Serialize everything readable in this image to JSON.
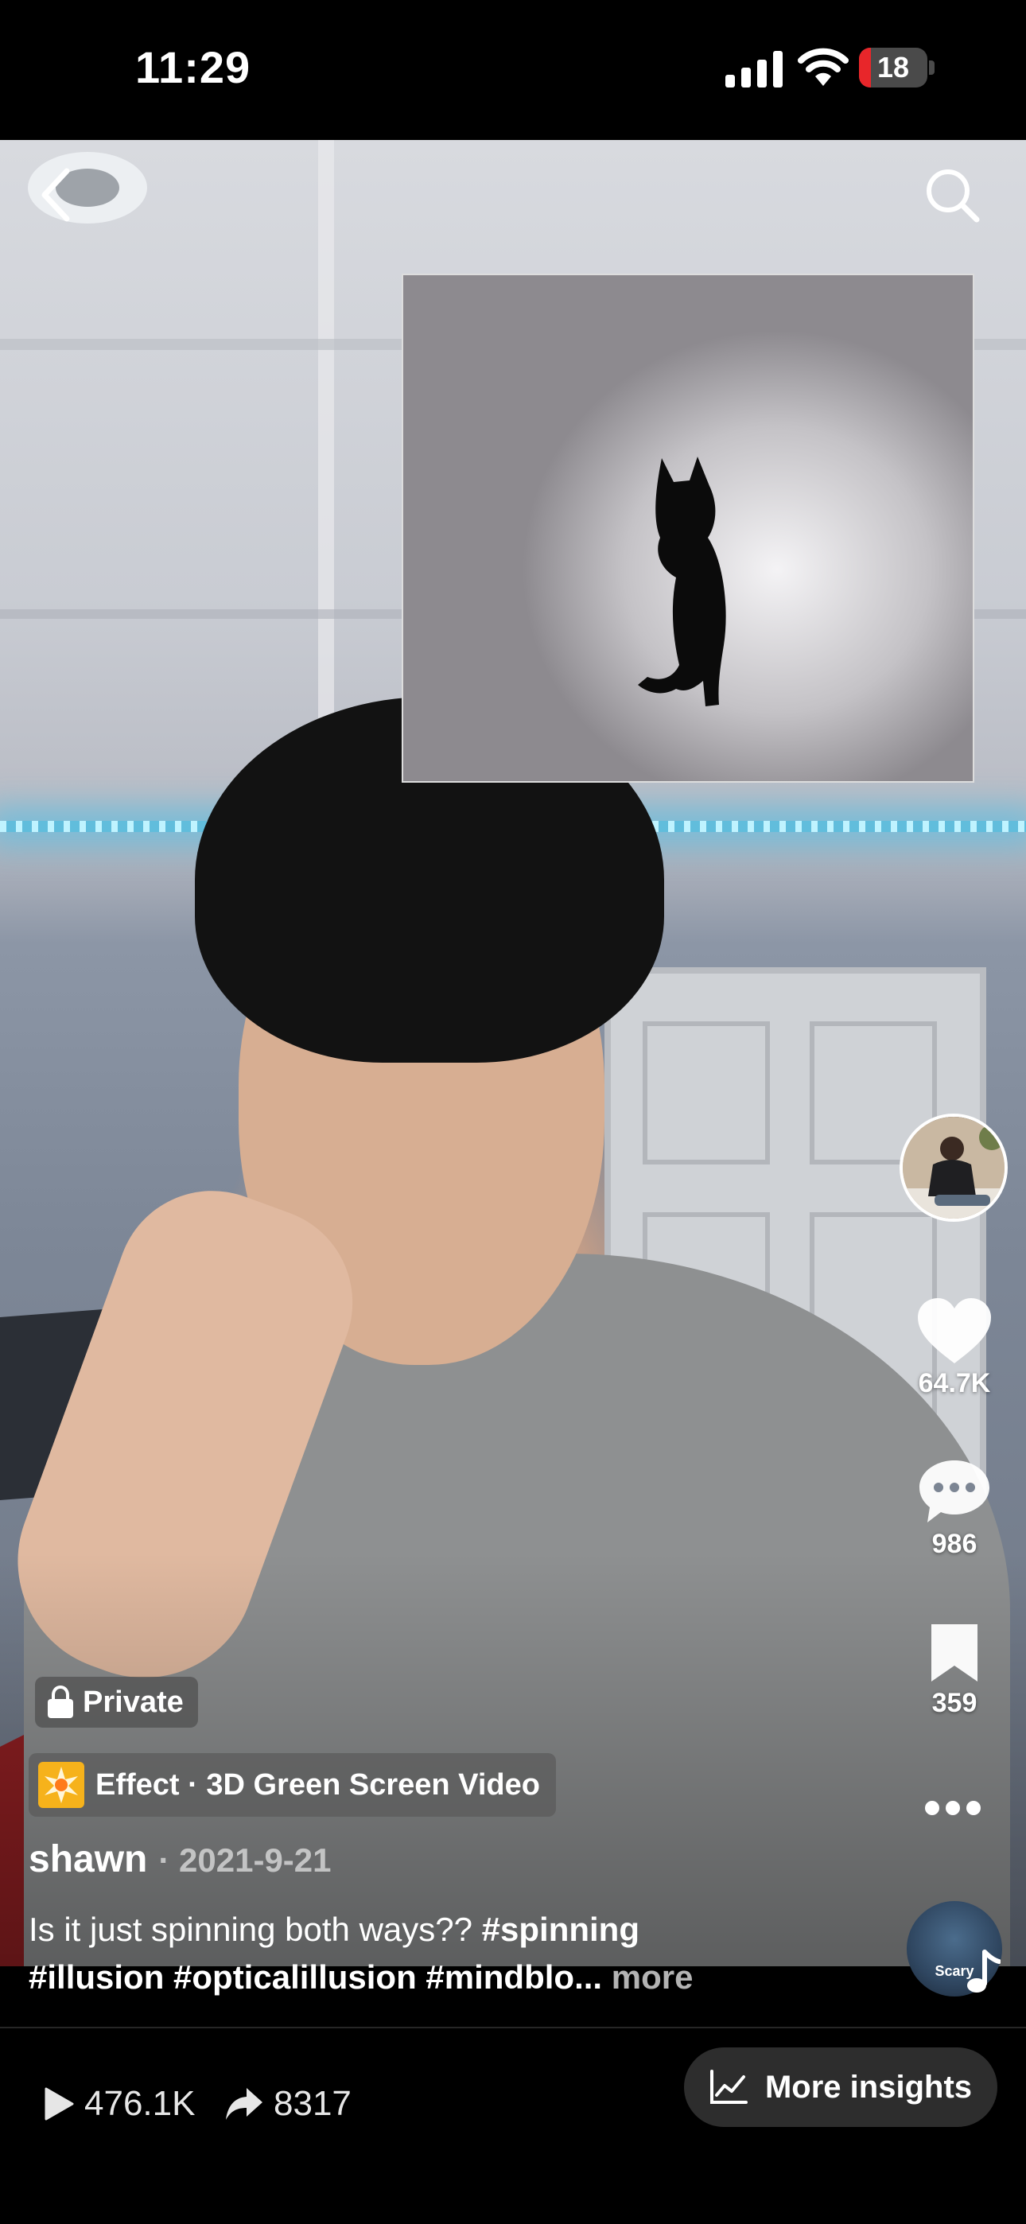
{
  "status_bar": {
    "time": "11:29",
    "battery_level": "18",
    "battery_fraction": 0.18,
    "battery_color": "#e8262a"
  },
  "nav": {
    "back_icon": "chevron-left-icon",
    "search_icon": "search-icon"
  },
  "actions": {
    "likes": "64.7K",
    "comments": "986",
    "saves": "359",
    "more_icon": "ellipsis-icon",
    "music_disc_label": "Scary"
  },
  "post": {
    "privacy_label": "Private",
    "effect_label": "Effect · 3D Green Screen Video",
    "author": "shawn",
    "date": "· 2021-9-21",
    "caption_text": "Is it just spinning both ways?? ",
    "caption_tags_line1": "#spinning",
    "caption_tags_line2": "#illusion #opticalillusion #mindblo...",
    "more_label": " more"
  },
  "stats": {
    "views": "476.1K",
    "shares": "8317",
    "insights_label": "More insights"
  },
  "colors": {
    "background": "#000000",
    "led_glow": "#3cbeeb",
    "effect_badge_icon": "#f6b21b"
  }
}
